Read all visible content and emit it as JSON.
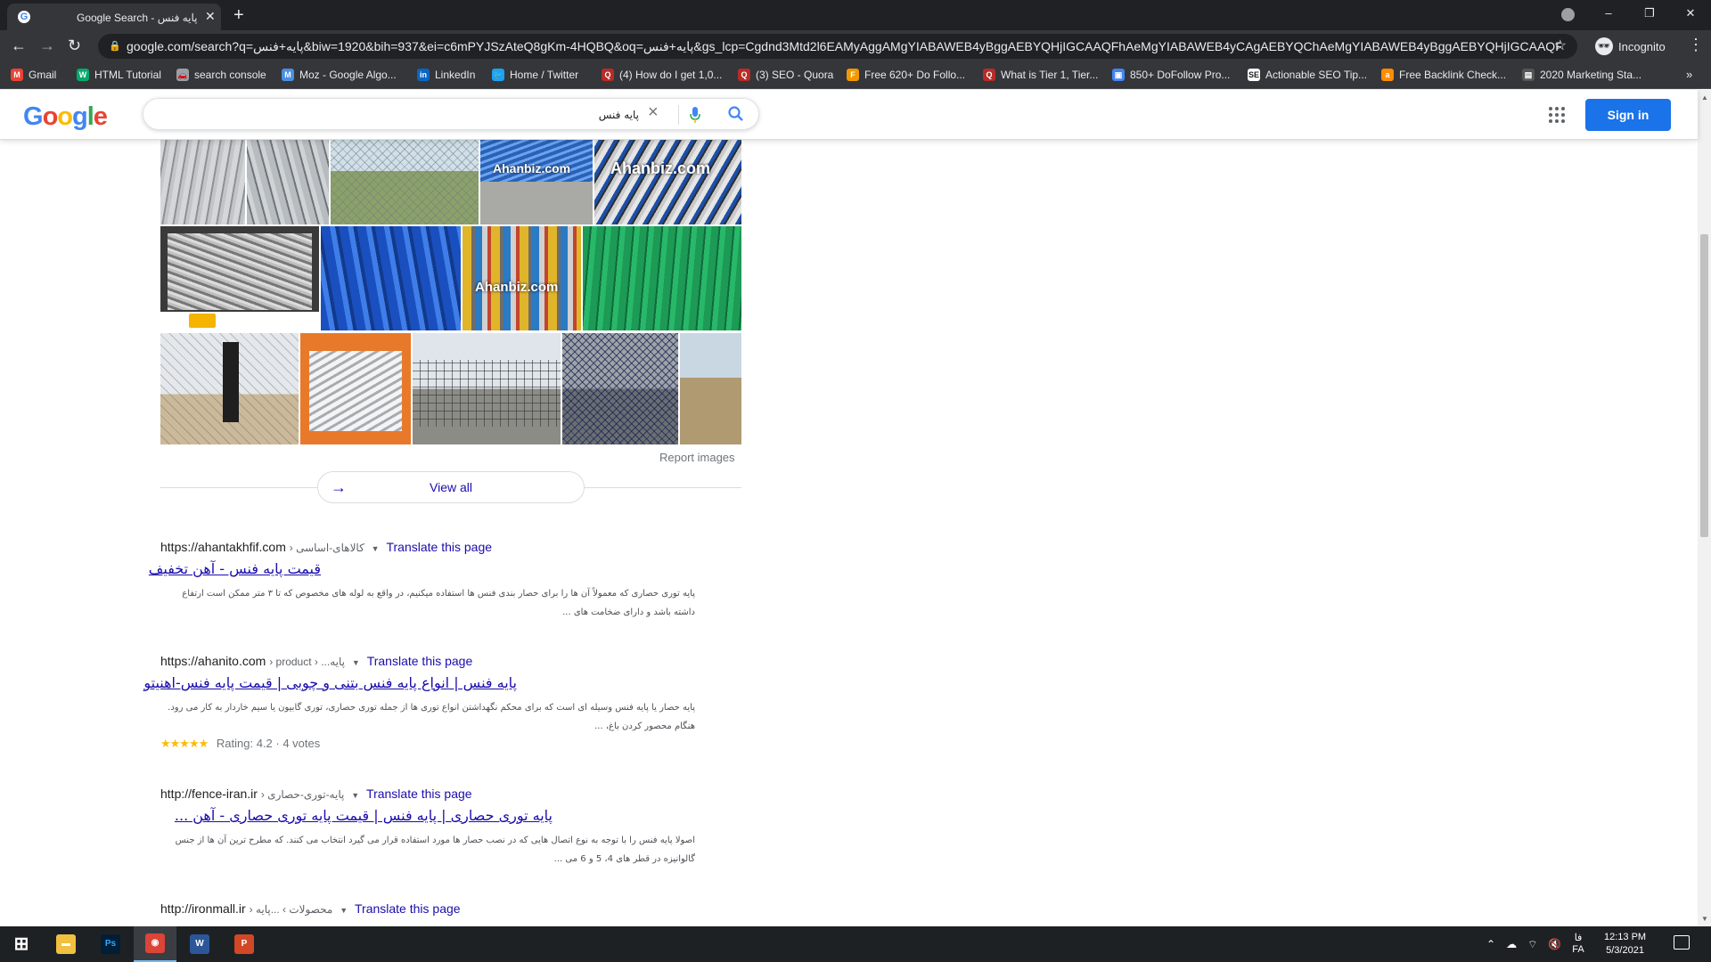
{
  "browser": {
    "tab_title": "Google Search - پایه فنس",
    "url": "google.com/search?q=پایه+فنس&biw=1920&bih=937&ei=c6mPYJSzAteQ8gKm-4HQBQ&oq=پایه+فنس&gs_lcp=Cgdnd3Mtd2l6EAMyAggAMgYIABAWEB4yBggAEBYQHjIGCAAQFhAeMgYIABAWEB4yCAgAEBYQChAeMgYIABAWEB4yBggAEBYQHjIGCAAQFhA...",
    "profile_label": "Incognito",
    "window_controls": {
      "minimize": "–",
      "restore": "❐",
      "close": "✕"
    }
  },
  "bookmarks": [
    {
      "label": "Gmail",
      "icon": "gmail-icon",
      "color": "#ea4335",
      "glyph": "M"
    },
    {
      "label": "HTML Tutorial",
      "icon": "w3schools-icon",
      "color": "#04aa6d",
      "glyph": "W"
    },
    {
      "label": "search console",
      "icon": "search-console-icon",
      "color": "#9aa0a6",
      "glyph": "🚗"
    },
    {
      "label": "Moz - Google Algo...",
      "icon": "moz-icon",
      "color": "#4a90e2",
      "glyph": "M"
    },
    {
      "label": "LinkedIn",
      "icon": "linkedin-icon",
      "color": "#0a66c2",
      "glyph": "in"
    },
    {
      "label": "Home / Twitter",
      "icon": "twitter-icon",
      "color": "#1da1f2",
      "glyph": "🐦"
    },
    {
      "label": "(4) How do I get 1,0...",
      "icon": "quora-icon",
      "color": "#b92b27",
      "glyph": "Q"
    },
    {
      "label": "(3) SEO - Quora",
      "icon": "quora-icon",
      "color": "#b92b27",
      "glyph": "Q"
    },
    {
      "label": "Free 620+ Do Follo...",
      "icon": "site-icon",
      "color": "#f29900",
      "glyph": "F"
    },
    {
      "label": "What is Tier 1, Tier...",
      "icon": "quora-icon",
      "color": "#b92b27",
      "glyph": "Q"
    },
    {
      "label": "850+ DoFollow Pro...",
      "icon": "image-icon",
      "color": "#4285f4",
      "glyph": "▣"
    },
    {
      "label": "Actionable SEO Tip...",
      "icon": "sej-icon",
      "color": "#ffffff",
      "glyph": "SE"
    },
    {
      "label": "Free Backlink Check...",
      "icon": "ahrefs-icon",
      "color": "#ff8c00",
      "glyph": "a"
    },
    {
      "label": "2020 Marketing Sta...",
      "icon": "folder-image-icon",
      "color": "#555555",
      "glyph": "▤"
    }
  ],
  "google": {
    "logo_letters": [
      {
        "ch": "G",
        "color": "#4285f4"
      },
      {
        "ch": "o",
        "color": "#ea4335"
      },
      {
        "ch": "o",
        "color": "#fbbc05"
      },
      {
        "ch": "g",
        "color": "#4285f4"
      },
      {
        "ch": "l",
        "color": "#34a853"
      },
      {
        "ch": "e",
        "color": "#ea4335"
      }
    ],
    "query": "پایه فنس",
    "sign_in": "Sign in"
  },
  "images_section": {
    "watermark": "Ahanbiz.com",
    "report_images": "Report images",
    "view_all": "View all"
  },
  "results": [
    {
      "domain": "https://ahantakhfif.com",
      "crumbs": "› کالاهای-اساسی",
      "translate": "Translate this page",
      "title": "قیمت پایه فنس - آهن تخفیف",
      "snippet": "پایه توری حصاری که معمولاً آن ها را برای حصار بندی فنس ها استفاده میکنیم، در واقع به لوله های مخصوص که تا ۳ متر ممکن است ارتفاع داشته باشد و دارای ضخامت های ..."
    },
    {
      "domain": "https://ahanito.com",
      "crumbs": "› product › ...پایه",
      "translate": "Translate this page",
      "title": "پایه فنس | انواع پایه فنس بتنی و چوبی | قیمت پایه فنس-اهنیتو",
      "snippet": "پایه حصار یا پایه فنس وسیله ای است که برای محکم نگهداشتن انواع توری ها از جمله توری حصاری، توری گابیون یا سیم خاردار به کار می رود. هنگام محصور کردن باغ، ...",
      "rating_stars": "★★★★★",
      "rating_value": 4.2,
      "rating_text": "Rating: 4.2 · 4 votes"
    },
    {
      "domain": "http://fence-iran.ir",
      "crumbs": "› پایه-توری-حصاری",
      "translate": "Translate this page",
      "title": "پایه توری حصاری | پایه فنس | قیمت پایه توری حصاری - آهن ...",
      "snippet": "اصولا پایه فنس را با توجه به نوع اتصال هایی که در نصب حصار ها مورد استفاده قرار می گیرد انتخاب می کنند. که مطرح ترین آن ها از جنس گالوانیزه در قطر های 4، 5 و 6 می ..."
    },
    {
      "domain": "http://ironmall.ir",
      "crumbs": "› محصولات › ...پایه",
      "translate": "Translate this page"
    }
  ],
  "taskbar": {
    "apps": [
      {
        "name": "start-button",
        "glyph": "⊞",
        "color": "transparent"
      },
      {
        "name": "file-explorer",
        "glyph": "▬",
        "color": "#f0c040"
      },
      {
        "name": "photoshop",
        "glyph": "Ps",
        "color": "#001e36"
      },
      {
        "name": "chrome",
        "glyph": "◉",
        "color": "#db4437"
      },
      {
        "name": "word",
        "glyph": "W",
        "color": "#2b579a"
      },
      {
        "name": "powerpoint",
        "glyph": "P",
        "color": "#d24726"
      }
    ],
    "lang_top": "فا",
    "lang_bottom": "FA",
    "time": "12:13 PM",
    "date": "5/3/2021"
  },
  "colors": {
    "link": "#1a0dab",
    "signin_blue": "#1a73e8",
    "chrome_dark": "#202124",
    "chrome_toolbar": "#35363a"
  }
}
